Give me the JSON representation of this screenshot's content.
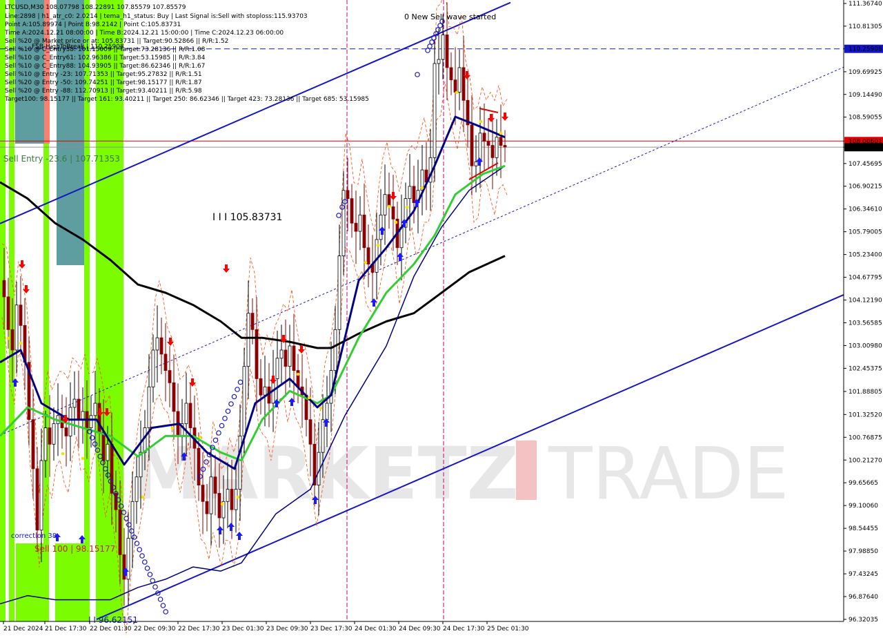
{
  "colors": {
    "background": "#ffffff",
    "bull_candle": "#000000",
    "bear_candle": "#8b0000",
    "channel": "#1515c8",
    "red_level": "#e00000",
    "green_ma": "#32cd32",
    "navy_ma": "#000080",
    "black_ma": "#000000",
    "zone_green": "#7cfc00",
    "zone_teal": "#5f9ea0",
    "zone_salmon": "#fa8072",
    "up_arrow": "#1a1aff",
    "down_arrow": "#ff0000",
    "current_price_bg": "#000000",
    "level_price_bg": "#e00000",
    "blue_level_bg": "#1515c8"
  },
  "header": {
    "lines": [
      "LTCUSD,M30  108.07798 108.22891 107.85579 107.85579",
      "Line:2898 | h1_atr_c0: 2.0214 | tema_h1_status: Buy | Last Signal is:Sell with stoploss:115.93703",
      "Point A:105.89974 | Point B:98.2142 | Point C:105.83731",
      "Time A:2024.12.21 08:00:00 | Time B:2024.12.21 15:00:00 | Time C:2024.12.23 06:00:00",
      "Sell %20 @ Market price or at: 105.83731 || Target:90.52866 || R/R:1.52",
      "Sell %10 @ C_Entry38: 101.15009 || Target:73.28136 || R/R:1.08",
      "Sell %10 @ C_Entry61: 102.96386 || Target:53.15985 || R/R:3.84",
      "Sell %10 @ C_Entry88: 104.93905 || Target:86.62346 || R/R:1.67",
      "Sell %10 @ Entry -23: 107.71353 || Target:95.27832 || R/R:1.51",
      "Sell %20 @ Entry -50: 109.74251 || Target:98.15177 || R/R:1.87",
      "Sell %20 @ Entry -88: 112.70913 || Target:93.40211 || R/R:5.98",
      "Target100: 98.15177 || Target 161: 93.40211 || Target 250: 86.62346 || Target 423: 73.28136 || Target 685: 53.15985"
    ],
    "overlay_text": "FSB-HighToBreak | 110.25908"
  },
  "annotations": {
    "wave_label": "0 New Sell wave started",
    "sell_entry": "Sell Entry -23.6 | 107.71353",
    "point_c": "I I I 105.83731",
    "correction": "correction 38",
    "sell_100": "Sell 100 | 98.15177",
    "bottom_label": "I I 96.62151"
  },
  "price_axis": {
    "ticks": [
      "111.36740",
      "110.81305",
      "110.25908",
      "109.69925",
      "109.14490",
      "108.59055",
      "108.00601",
      "107.85579",
      "107.45695",
      "106.90215",
      "106.34610",
      "105.79005",
      "105.23400",
      "104.67795",
      "104.12190",
      "103.56585",
      "103.00980",
      "102.45375",
      "101.88805",
      "101.32520",
      "100.76875",
      "100.21270",
      "99.65665",
      "99.10060",
      "98.54455",
      "97.98850",
      "97.43245",
      "96.87640",
      "96.32035"
    ],
    "current_price": "107.85579",
    "red_level": "108.00601",
    "blue_level": "110.25908"
  },
  "time_axis": {
    "ticks": [
      "21 Dec 2024",
      "21 Dec 17:30",
      "22 Dec 01:30",
      "22 Dec 09:30",
      "22 Dec 17:30",
      "23 Dec 01:30",
      "23 Dec 09:30",
      "23 Dec 17:30",
      "24 Dec 01:30",
      "24 Dec 09:30",
      "24 Dec 17:30",
      "25 Dec 01:30"
    ]
  },
  "watermark": {
    "left": "MARKETZ",
    "accent": "I",
    "right": "TRADE"
  },
  "chart_data": {
    "type": "candlestick",
    "title": "LTCUSD,M30",
    "symbol": "LTCUSD",
    "timeframe": "M30",
    "ohlc_last": {
      "open": 108.07798,
      "high": 108.22891,
      "low": 107.85579,
      "close": 107.85579
    },
    "ylim": [
      96.32035,
      111.3674
    ],
    "price_path": [
      [
        0,
        104.6
      ],
      [
        6,
        104.2
      ],
      [
        12,
        103.4
      ],
      [
        18,
        102.9
      ],
      [
        24,
        104.0
      ],
      [
        30,
        103.5
      ],
      [
        36,
        102.6
      ],
      [
        42,
        101.2
      ],
      [
        48,
        100.0
      ],
      [
        54,
        98.5
      ],
      [
        60,
        100.2
      ],
      [
        66,
        101.0
      ],
      [
        72,
        100.6
      ],
      [
        78,
        101.1
      ],
      [
        84,
        101.3
      ],
      [
        90,
        101.0
      ],
      [
        96,
        100.8
      ],
      [
        102,
        101.5
      ],
      [
        108,
        101.7
      ],
      [
        114,
        101.2
      ],
      [
        120,
        101.4
      ],
      [
        126,
        101.0
      ],
      [
        132,
        101.3
      ],
      [
        138,
        101.6
      ],
      [
        144,
        100.9
      ],
      [
        150,
        100.2
      ],
      [
        156,
        100.6
      ],
      [
        162,
        99.4
      ],
      [
        168,
        99.0
      ],
      [
        174,
        97.9
      ],
      [
        180,
        97.3
      ],
      [
        186,
        98.3
      ],
      [
        192,
        99.2
      ],
      [
        198,
        99.8
      ],
      [
        204,
        100.4
      ],
      [
        210,
        101.0
      ],
      [
        216,
        102.0
      ],
      [
        222,
        102.9
      ],
      [
        228,
        103.2
      ],
      [
        234,
        102.8
      ],
      [
        240,
        102.4
      ],
      [
        246,
        102.1
      ],
      [
        252,
        101.4
      ],
      [
        258,
        100.8
      ],
      [
        264,
        101.1
      ],
      [
        270,
        101.6
      ],
      [
        276,
        101.0
      ],
      [
        282,
        100.5
      ],
      [
        288,
        99.6
      ],
      [
        294,
        99.2
      ],
      [
        300,
        98.9
      ],
      [
        306,
        99.8
      ],
      [
        312,
        99.4
      ],
      [
        318,
        98.8
      ],
      [
        324,
        99.2
      ],
      [
        330,
        99.5
      ],
      [
        336,
        99.0
      ],
      [
        342,
        99.5
      ],
      [
        348,
        100.8
      ],
      [
        354,
        102.5
      ],
      [
        360,
        103.8
      ],
      [
        366,
        103.4
      ],
      [
        372,
        102.2
      ],
      [
        378,
        101.8
      ],
      [
        384,
        102.0
      ],
      [
        390,
        101.6
      ],
      [
        396,
        102.2
      ],
      [
        402,
        102.7
      ],
      [
        408,
        102.9
      ],
      [
        414,
        102.5
      ],
      [
        420,
        103.0
      ],
      [
        426,
        102.4
      ],
      [
        432,
        102.0
      ],
      [
        438,
        101.8
      ],
      [
        444,
        101.2
      ],
      [
        450,
        100.6
      ],
      [
        456,
        99.6
      ],
      [
        462,
        100.4
      ],
      [
        468,
        101.2
      ],
      [
        474,
        101.6
      ],
      [
        480,
        102.4
      ],
      [
        486,
        103.4
      ],
      [
        492,
        105.2
      ],
      [
        498,
        106.8
      ],
      [
        504,
        106.6
      ],
      [
        510,
        106.0
      ],
      [
        516,
        105.8
      ],
      [
        522,
        106.2
      ],
      [
        528,
        105.4
      ],
      [
        534,
        105.0
      ],
      [
        540,
        104.8
      ],
      [
        546,
        105.6
      ],
      [
        552,
        106.2
      ],
      [
        558,
        106.7
      ],
      [
        564,
        106.4
      ],
      [
        570,
        106.1
      ],
      [
        576,
        105.4
      ],
      [
        582,
        105.9
      ],
      [
        588,
        106.6
      ],
      [
        594,
        106.9
      ],
      [
        600,
        106.5
      ],
      [
        606,
        106.8
      ],
      [
        612,
        107.3
      ],
      [
        618,
        107.0
      ],
      [
        624,
        107.6
      ],
      [
        630,
        109.9
      ],
      [
        636,
        110.0
      ],
      [
        642,
        110.6
      ],
      [
        648,
        109.8
      ],
      [
        654,
        109.5
      ],
      [
        660,
        109.2
      ],
      [
        666,
        109.8
      ],
      [
        672,
        109.0
      ],
      [
        678,
        108.4
      ],
      [
        684,
        107.4
      ],
      [
        690,
        107.5
      ],
      [
        696,
        108.2
      ],
      [
        702,
        108.0
      ],
      [
        708,
        107.9
      ],
      [
        714,
        107.6
      ],
      [
        720,
        108.1
      ],
      [
        726,
        107.9
      ],
      [
        732,
        107.86
      ]
    ],
    "lines": {
      "ma_black": [
        [
          0,
          107.0
        ],
        [
          40,
          106.6
        ],
        [
          80,
          106.0
        ],
        [
          120,
          105.6
        ],
        [
          160,
          105.1
        ],
        [
          200,
          104.5
        ],
        [
          240,
          104.3
        ],
        [
          280,
          104.0
        ],
        [
          320,
          103.6
        ],
        [
          350,
          103.2
        ],
        [
          380,
          103.2
        ],
        [
          420,
          103.1
        ],
        [
          460,
          102.95
        ],
        [
          480,
          102.95
        ],
        [
          520,
          103.3
        ],
        [
          560,
          103.6
        ],
        [
          600,
          103.8
        ],
        [
          640,
          104.3
        ],
        [
          680,
          104.8
        ],
        [
          732,
          105.2
        ]
      ],
      "ma_green": [
        [
          0,
          100.8
        ],
        [
          40,
          101.5
        ],
        [
          80,
          101.2
        ],
        [
          120,
          101.0
        ],
        [
          160,
          100.8
        ],
        [
          200,
          100.3
        ],
        [
          240,
          100.8
        ],
        [
          280,
          100.8
        ],
        [
          320,
          100.4
        ],
        [
          350,
          100.2
        ],
        [
          380,
          101.2
        ],
        [
          420,
          101.9
        ],
        [
          460,
          101.6
        ],
        [
          480,
          101.8
        ],
        [
          520,
          103.2
        ],
        [
          560,
          104.3
        ],
        [
          600,
          105.0
        ],
        [
          630,
          105.7
        ],
        [
          660,
          106.7
        ],
        [
          700,
          107.2
        ],
        [
          732,
          107.4
        ]
      ],
      "ma_navy": [
        [
          0,
          102.6
        ],
        [
          30,
          102.9
        ],
        [
          60,
          101.6
        ],
        [
          100,
          101.2
        ],
        [
          140,
          101.2
        ],
        [
          180,
          100.1
        ],
        [
          220,
          101.0
        ],
        [
          260,
          101.1
        ],
        [
          300,
          100.4
        ],
        [
          340,
          100.0
        ],
        [
          370,
          101.6
        ],
        [
          420,
          102.2
        ],
        [
          460,
          101.5
        ],
        [
          480,
          101.8
        ],
        [
          500,
          103.2
        ],
        [
          520,
          104.6
        ],
        [
          560,
          105.4
        ],
        [
          600,
          106.3
        ],
        [
          630,
          107.4
        ],
        [
          660,
          108.6
        ],
        [
          690,
          108.4
        ],
        [
          732,
          108.1
        ]
      ],
      "ma_navy_slow": [
        [
          0,
          96.7
        ],
        [
          40,
          96.9
        ],
        [
          80,
          96.8
        ],
        [
          120,
          96.8
        ],
        [
          160,
          96.8
        ],
        [
          200,
          97.1
        ],
        [
          240,
          97.3
        ],
        [
          280,
          97.6
        ],
        [
          320,
          97.5
        ],
        [
          350,
          97.7
        ],
        [
          400,
          98.9
        ],
        [
          450,
          99.5
        ],
        [
          500,
          101.3
        ],
        [
          560,
          103.0
        ],
        [
          600,
          104.7
        ],
        [
          640,
          105.9
        ],
        [
          680,
          106.8
        ],
        [
          732,
          107.4
        ]
      ]
    },
    "channel": {
      "upper": [
        [
          0,
          105.99
        ],
        [
          740,
          111.39
        ]
      ],
      "lower": [
        [
          140,
          96.32
        ],
        [
          1223,
          104.25
        ]
      ],
      "mid_dotted": [
        [
          0,
          100.82
        ],
        [
          1223,
          109.81
        ]
      ]
    },
    "levels": {
      "blue_dashed": 110.25908,
      "red": 108.00601,
      "grey": 107.85579
    },
    "vertical_markers_time": [
      "23 Dec 17:30",
      "24 Dec 17:30"
    ]
  }
}
